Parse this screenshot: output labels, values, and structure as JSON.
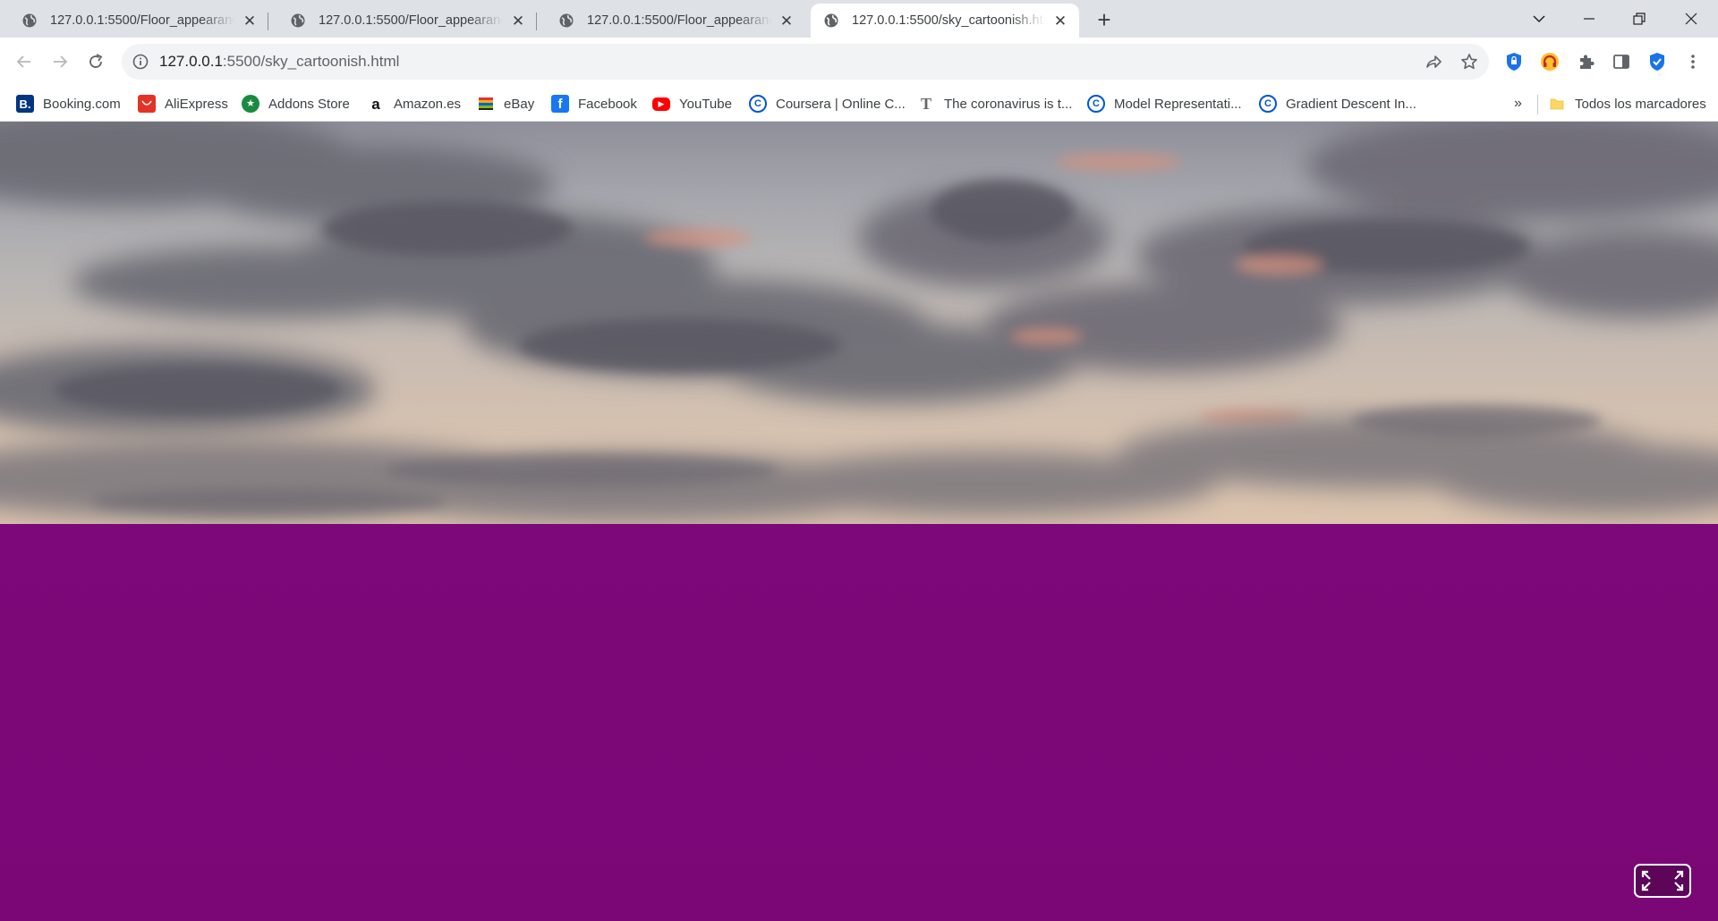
{
  "tabs": [
    {
      "title": "127.0.0.1:5500/Floor_appearance",
      "active": false
    },
    {
      "title": "127.0.0.1:5500/Floor_appearance",
      "active": false
    },
    {
      "title": "127.0.0.1:5500/Floor_appearance",
      "active": false
    },
    {
      "title": "127.0.0.1:5500/sky_cartoonish.html",
      "active": true
    }
  ],
  "toolbar": {
    "url_host": "127.0.0.1",
    "url_path": ":5500/sky_cartoonish.html"
  },
  "bookmarks": [
    {
      "label": "Booking.com",
      "icon": "booking-icon",
      "glyph": "B.",
      "color": "#003580"
    },
    {
      "label": "AliExpress",
      "icon": "aliexpress-icon",
      "glyph": "",
      "color": "#e43225"
    },
    {
      "label": "Addons Store",
      "icon": "addons-store-icon",
      "glyph": "★",
      "color": "#1a8a3f"
    },
    {
      "label": "Amazon.es",
      "icon": "amazon-icon",
      "glyph": "a",
      "color": "#111111"
    },
    {
      "label": "eBay",
      "icon": "ebay-icon",
      "glyph": "",
      "color": "#e53238"
    },
    {
      "label": "Facebook",
      "icon": "facebook-icon",
      "glyph": "f",
      "color": "#1877f2"
    },
    {
      "label": "YouTube",
      "icon": "youtube-icon",
      "glyph": "▶",
      "color": "#ff0000"
    },
    {
      "label": "Coursera | Online C...",
      "icon": "coursera-icon",
      "glyph": "C",
      "color": "#0056d2"
    },
    {
      "label": "The coronavirus is t...",
      "icon": "tmagazine-icon",
      "glyph": "T",
      "color": "#666666"
    },
    {
      "label": "Model Representati...",
      "icon": "coursera-icon",
      "glyph": "C",
      "color": "#0056d2"
    },
    {
      "label": "Gradient Descent In...",
      "icon": "coursera-icon",
      "glyph": "C",
      "color": "#0056d2"
    }
  ],
  "bookmarks_overflow": "»",
  "all_bookmarks_label": "Todos los marcadores",
  "scene": {
    "sky_color_top": "#8e8f98",
    "sky_color_horizon": "#dcc4ae",
    "floor_color": "#7b0777"
  }
}
